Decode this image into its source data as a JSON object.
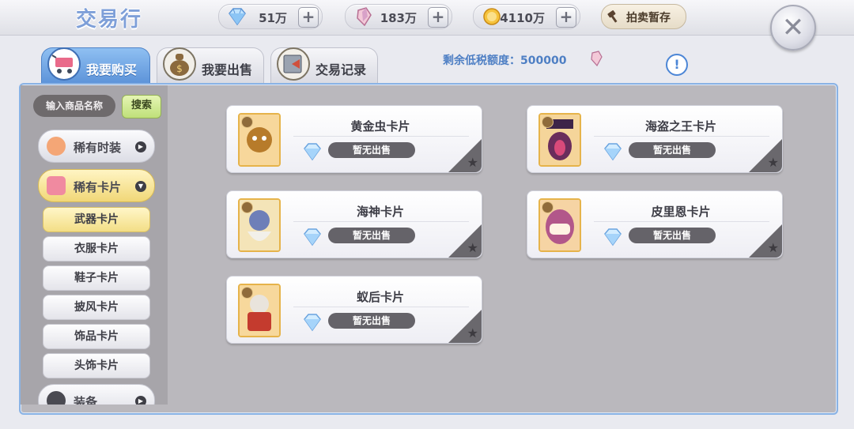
{
  "header": {
    "title": "交易行",
    "currencies": [
      {
        "icon": "diamond-icon",
        "value": "51万"
      },
      {
        "icon": "crystal-icon",
        "value": "183万"
      },
      {
        "icon": "gold-coin-icon",
        "value": "4110万"
      }
    ],
    "auction_button": "拍卖暂存",
    "close_symbol": "✕"
  },
  "tabs": [
    {
      "label": "我要购买",
      "icon": "cart-icon",
      "active": true
    },
    {
      "label": "我要出售",
      "icon": "money-bag-icon",
      "active": false
    },
    {
      "label": "交易记录",
      "icon": "ledger-icon",
      "active": false
    }
  ],
  "tax": {
    "label": "剩余低税额度：500000",
    "icon": "crystal-icon"
  },
  "info_symbol": "!",
  "search": {
    "placeholder": "输入商品名称",
    "button": "搜索"
  },
  "categories": [
    {
      "label": "稀有时装",
      "expanded": false
    },
    {
      "label": "稀有卡片",
      "expanded": true
    },
    {
      "label": "装备",
      "expanded": false
    }
  ],
  "subcategories": [
    {
      "label": "武器卡片",
      "active": true
    },
    {
      "label": "衣服卡片",
      "active": false
    },
    {
      "label": "鞋子卡片",
      "active": false
    },
    {
      "label": "披风卡片",
      "active": false
    },
    {
      "label": "饰品卡片",
      "active": false
    },
    {
      "label": "头饰卡片",
      "active": false
    }
  ],
  "cards": [
    {
      "name": "黄金虫卡片",
      "status": "暂无出售",
      "color": "#b77b2a"
    },
    {
      "name": "海盗之王卡片",
      "status": "暂无出售",
      "color": "#6a2d5c"
    },
    {
      "name": "海神卡片",
      "status": "暂无出售",
      "color": "#6e7fb8"
    },
    {
      "name": "皮里恩卡片",
      "status": "暂无出售",
      "color": "#b2578a"
    },
    {
      "name": "蚁后卡片",
      "status": "暂无出售",
      "color": "#c43b2e"
    }
  ]
}
